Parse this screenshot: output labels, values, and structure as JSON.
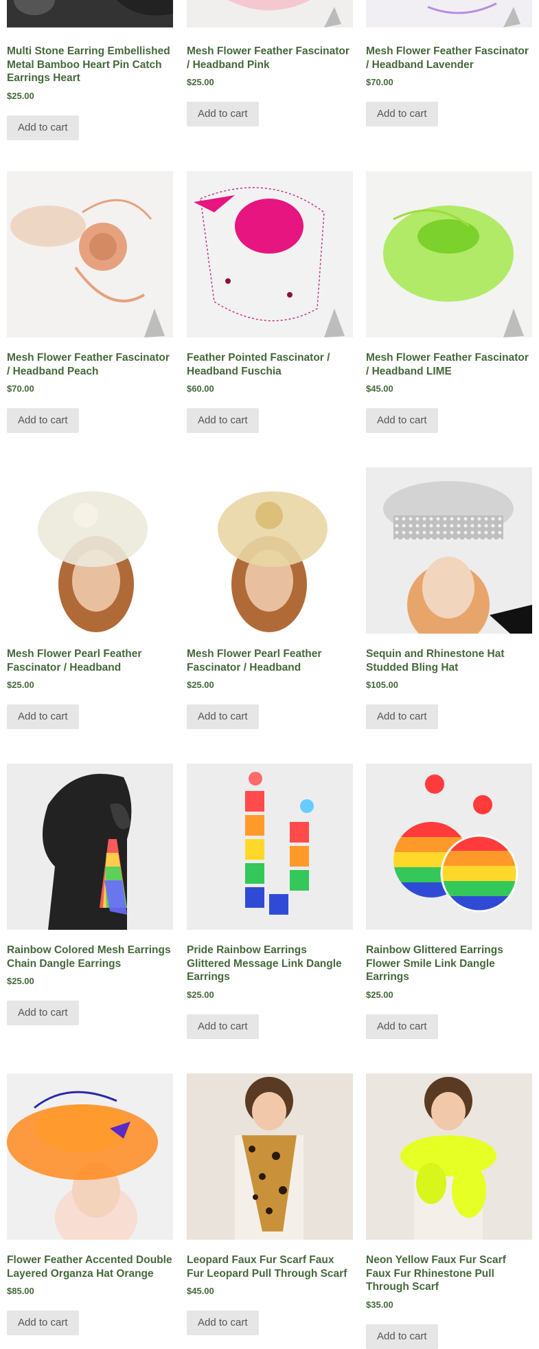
{
  "products": [
    {
      "title": "Multi Stone Earring Embellished Metal Bamboo Heart Pin Catch Earrings Heart",
      "price": "$25.00",
      "button": "Add to cart",
      "image": "earring-on-black-bust"
    },
    {
      "title": "Mesh Flower Feather Fascinator / Headband Pink",
      "price": "$25.00",
      "button": "Add to cart",
      "image": "pink-fascinator"
    },
    {
      "title": "Mesh Flower Feather Fascinator / Headband Lavender",
      "price": "$70.00",
      "button": "Add to cart",
      "image": "lavender-fascinator"
    },
    {
      "title": "Mesh Flower Feather Fascinator / Headband Peach",
      "price": "$70.00",
      "button": "Add to cart",
      "image": "peach-fascinator"
    },
    {
      "title": "Feather Pointed Fascinator / Headband Fuschia",
      "price": "$60.00",
      "button": "Add to cart",
      "image": "fuschia-fascinator"
    },
    {
      "title": "Mesh Flower Feather Fascinator / Headband LIME",
      "price": "$45.00",
      "button": "Add to cart",
      "image": "lime-fascinator"
    },
    {
      "title": "Mesh Flower Pearl Feather Fascinator / Headband",
      "price": "$25.00",
      "button": "Add to cart",
      "image": "ivory-fascinator-on-model"
    },
    {
      "title": "Mesh Flower Pearl Feather Fascinator / Headband",
      "price": "$25.00",
      "button": "Add to cart",
      "image": "gold-fascinator-on-model"
    },
    {
      "title": "Sequin and Rhinestone Hat Studded Bling Hat",
      "price": "$105.00",
      "button": "Add to cart",
      "image": "rhinestone-captain-hat"
    },
    {
      "title": "Rainbow Colored Mesh Earrings Chain Dangle Earrings",
      "price": "$25.00",
      "button": "Add to cart",
      "image": "rainbow-mesh-earring"
    },
    {
      "title": "Pride Rainbow Earrings Glittered Message Link Dangle Earrings",
      "price": "$25.00",
      "button": "Add to cart",
      "image": "pride-letter-earrings"
    },
    {
      "title": "Rainbow Glittered Earrings Flower Smile Link Dangle Earrings",
      "price": "$25.00",
      "button": "Add to cart",
      "image": "rainbow-smile-earrings"
    },
    {
      "title": "Flower Feather Accented Double Layered Organza Hat Orange",
      "price": "$85.00",
      "button": "Add to cart",
      "image": "orange-organza-hat"
    },
    {
      "title": "Leopard Faux Fur Scarf Faux Fur Leopard Pull Through Scarf",
      "price": "$45.00",
      "button": "Add to cart",
      "image": "leopard-fur-scarf"
    },
    {
      "title": "Neon Yellow Faux Fur Scarf Faux Fur Rhinestone Pull Through Scarf",
      "price": "$35.00",
      "button": "Add to cart",
      "image": "neon-yellow-fur-scarf"
    }
  ],
  "colors": {
    "title": "#44683a",
    "button_bg": "#e6e6e6",
    "image_bg": "#ededed"
  }
}
